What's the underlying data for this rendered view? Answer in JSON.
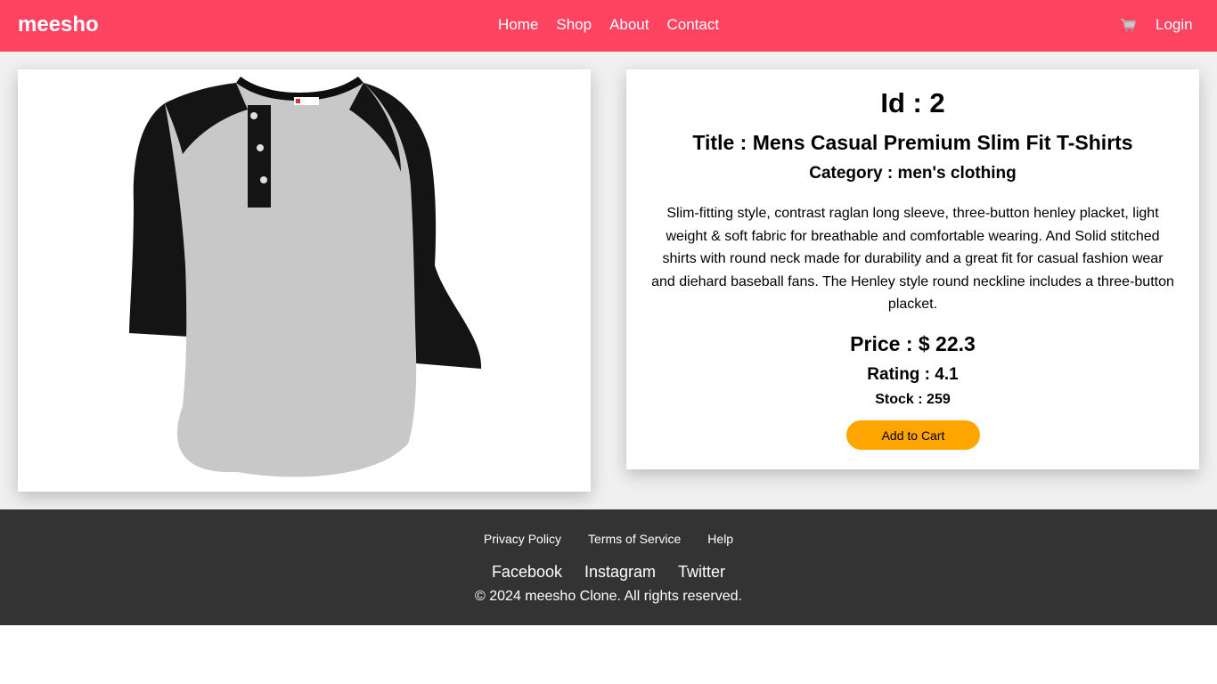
{
  "brand": {
    "name": "meesho",
    "color": "#ff4462"
  },
  "nav": {
    "items": [
      "Home",
      "Shop",
      "About",
      "Contact"
    ],
    "cart_icon": "cart-icon",
    "login": "Login"
  },
  "product": {
    "id_label": "Id : 2",
    "title_label": "Title : Mens Casual Premium Slim Fit T-Shirts",
    "category_label": "Category : men's clothing",
    "description": "Slim-fitting style, contrast raglan long sleeve, three-button henley placket, light weight & soft fabric for breathable and comfortable wearing. And Solid stitched shirts with round neck made for durability and a great fit for casual fashion wear and diehard baseball fans. The Henley style round neckline includes a three-button placket.",
    "price_label": "Price : $ 22.3",
    "rating_label": "Rating : 4.1",
    "stock_label": "Stock : 259",
    "add_to_cart": "Add to Cart",
    "button_color": "#ffa500"
  },
  "footer": {
    "links": [
      "Privacy Policy",
      "Terms of Service",
      "Help"
    ],
    "social": [
      "Facebook",
      "Instagram",
      "Twitter"
    ],
    "copyright": "© 2024 meesho Clone. All rights reserved.",
    "background": "#333333"
  }
}
